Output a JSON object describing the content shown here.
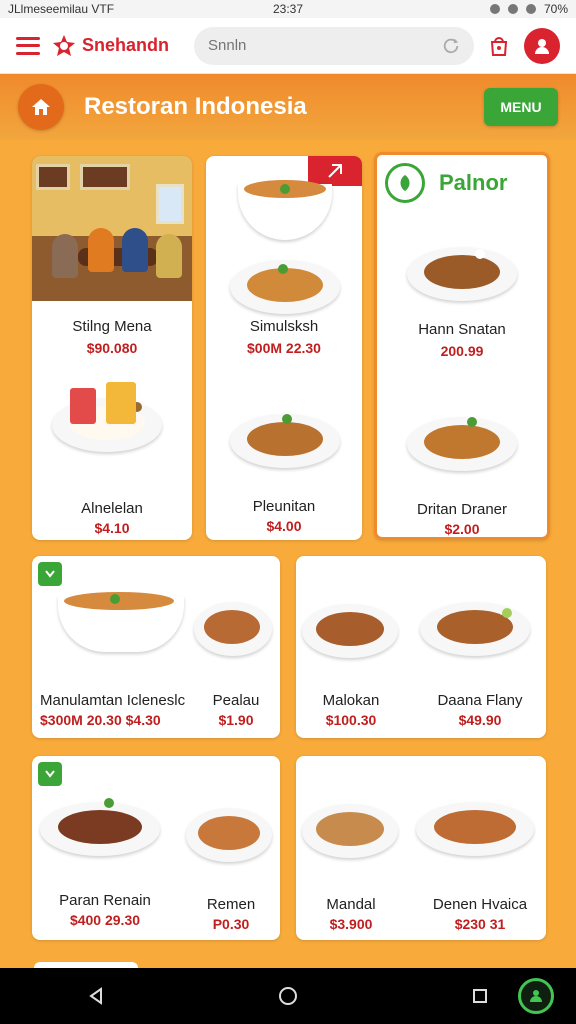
{
  "status": {
    "left": "JLlmeseemilau   VTF",
    "time": "23:37",
    "battery": "70%"
  },
  "app": {
    "brand": "Snehandn",
    "search_placeholder": "Snnln"
  },
  "restaurant": {
    "title": "Restoran Indonesia",
    "menu_label": "MENU"
  },
  "featured": {
    "badge": "Palnor"
  },
  "items": [
    {
      "name": "Stilng Mena",
      "price": "$90.080"
    },
    {
      "name": "Simulsksh",
      "price": "$00M 22.30"
    },
    {
      "name": "Hann Snatan",
      "price": "200.99"
    },
    {
      "name": "Alnelelan",
      "price": "$4.10"
    },
    {
      "name": "Pleunitan",
      "price": "$4.00"
    },
    {
      "name": "Dritan Draner",
      "price": "$2.00"
    },
    {
      "name": "Manulamtan Icleneslc",
      "price": "$300M 20.30 $4.30"
    },
    {
      "name": "Pealau",
      "price": "$1.90"
    },
    {
      "name": "Malokan",
      "price": "$100.30"
    },
    {
      "name": "Daana Flany",
      "price": "$49.90"
    },
    {
      "name": "Paran Renain",
      "price": "$400 29.30"
    },
    {
      "name": "Remen",
      "price": "P0.30"
    },
    {
      "name": "Mandal",
      "price": "$3.900"
    },
    {
      "name": "Denen Hvaica",
      "price": "$230 31"
    }
  ],
  "icons": {
    "menu": "hamburger-menu-icon",
    "search": "refresh-search-icon",
    "bag": "shopping-bag-icon",
    "profile": "user-profile-icon",
    "home": "home-icon",
    "back": "back-triangle-icon",
    "nav_home": "circle-home-icon",
    "recents": "square-recents-icon",
    "assistant": "assistant-icon"
  },
  "colors": {
    "brand_red": "#d9232e",
    "menu_green": "#3aa638",
    "background_orange": "#f8ab3b"
  }
}
